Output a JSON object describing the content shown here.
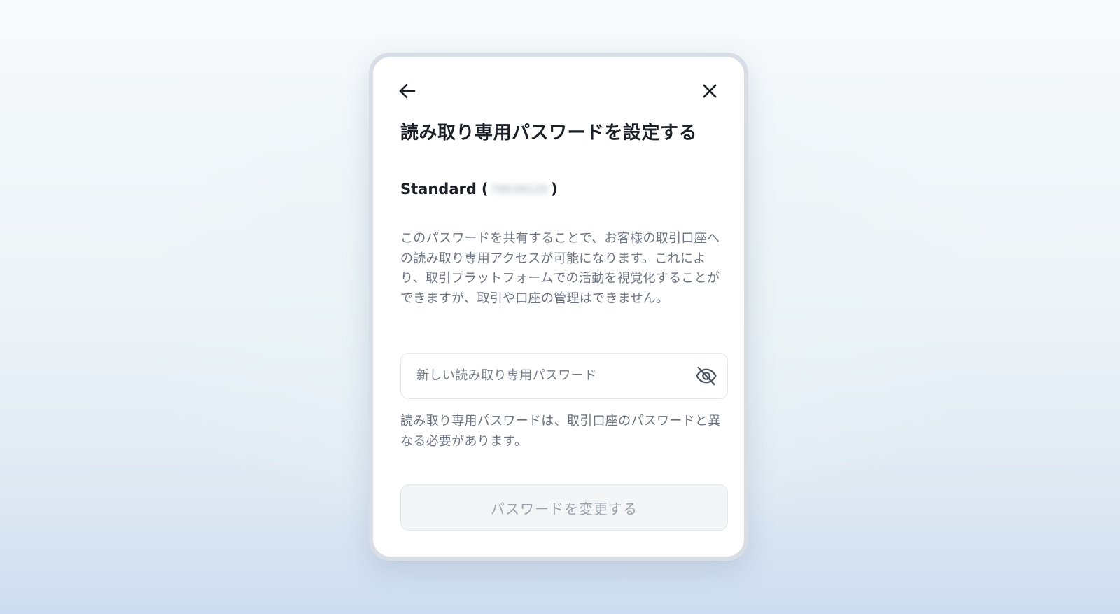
{
  "dialog": {
    "title": "読み取り専用パスワードを設定する",
    "account": {
      "type_label": "Standard",
      "open_paren": "(",
      "id_redacted": "79539125",
      "close_paren": ")"
    },
    "description": "このパスワードを共有することで、お客様の取引口座への読み取り専用アクセスが可能になります。これにより、取引プラットフォームでの活動を視覚化することができますが、取引や口座の管理はできません。",
    "password_field": {
      "placeholder": "新しい読み取り専用パスワード",
      "value": "",
      "visibility_icon": "eye-off-icon"
    },
    "helper_text": "読み取り専用パスワードは、取引口座のパスワードと異なる必要があります。",
    "submit_label": "パスワードを変更する",
    "submit_enabled": false,
    "icons": {
      "back": "arrow-left-icon",
      "close": "close-icon"
    },
    "colors": {
      "title_text": "#1b1f27",
      "body_text": "#6b7380",
      "disabled_button_text": "#99a1ab",
      "disabled_button_bg": "#f3f5f7"
    }
  }
}
